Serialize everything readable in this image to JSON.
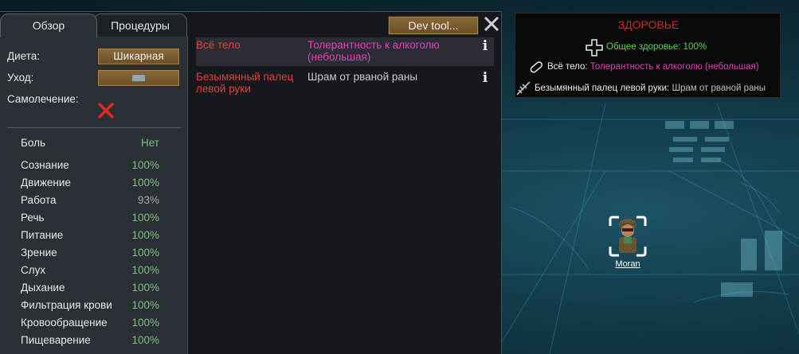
{
  "tabs": [
    {
      "label": "Обзор",
      "active": true
    },
    {
      "label": "Процедуры",
      "active": false
    }
  ],
  "overview": {
    "diet_label": "Диета:",
    "diet_value": "Шикарная",
    "care_label": "Уход:",
    "care_icon": "medical-care-icon",
    "self_tend_label": "Самолечение:",
    "self_tend_value_icon": "red-x-icon"
  },
  "capacities": [
    {
      "name": "Боль",
      "value": "Нет"
    },
    {
      "name": "Сознание",
      "value": "100%"
    },
    {
      "name": "Движение",
      "value": "100%"
    },
    {
      "name": "Работа",
      "value": "93%"
    },
    {
      "name": "Речь",
      "value": "100%"
    },
    {
      "name": "Питание",
      "value": "100%"
    },
    {
      "name": "Зрение",
      "value": "100%"
    },
    {
      "name": "Слух",
      "value": "100%"
    },
    {
      "name": "Дыхание",
      "value": "100%"
    },
    {
      "name": "Фильтрация крови",
      "value": "100%"
    },
    {
      "name": "Кровообращение",
      "value": "100%"
    },
    {
      "name": "Пищеварение",
      "value": "100%"
    }
  ],
  "toolbar": {
    "dev_label": "Dev tool...",
    "close_icon": "close-icon"
  },
  "health_rows": [
    {
      "part": "Всё тело",
      "condition": "Толерантность к алкоголю (небольшая)",
      "info_icon": "info-icon"
    },
    {
      "part": "Безымянный палец левой руки",
      "condition": "Шрам от рваной раны",
      "info_icon": "info-icon"
    }
  ],
  "tooltip": {
    "title": "ЗДОРОВЬЕ",
    "overall": "Общее здоровье: 100%",
    "line1_part": "Всё тело:",
    "line1_cond": "Толерантность к алкоголю (небольшая)",
    "line2_part": "Безымянный палец левой руки:",
    "line2_cond": "Шрам от рваной раны"
  },
  "pawn": {
    "name": "Moran"
  },
  "colors": {
    "injury_part": "#e0413c",
    "pink_condition": "#e63fbe",
    "good_value": "#7fbf7f",
    "button_brown": "#7a5c30",
    "tooltip_title": "#d02a22"
  }
}
